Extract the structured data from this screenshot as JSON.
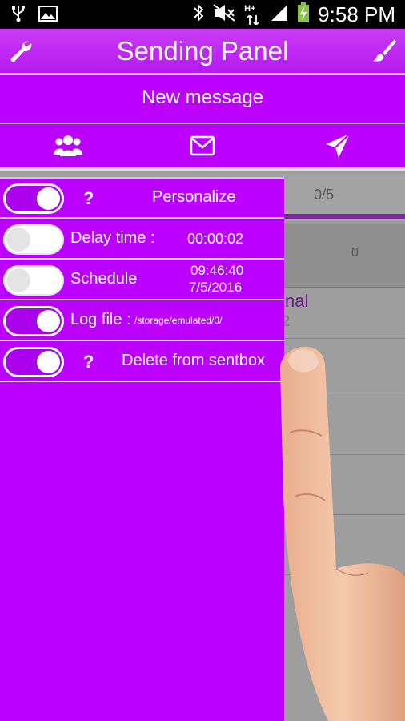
{
  "status_bar": {
    "time": "9:58 PM",
    "icons": [
      "usb-icon",
      "image-icon",
      "bluetooth-icon",
      "mute-icon",
      "hplus-signal-icon",
      "signal-icon",
      "battery-charging-icon"
    ],
    "network_label": "H+"
  },
  "header": {
    "title": "Sending Panel",
    "left_icon": "wrench-icon",
    "right_icon": "brush-icon",
    "color": "#bb00ff"
  },
  "subheader": {
    "title": "New message"
  },
  "icon_bar": {
    "icons": [
      "contacts-icon",
      "envelope-icon",
      "send-icon"
    ]
  },
  "background": {
    "counter": "0/5",
    "zero": "0",
    "fragment1": "nal",
    "fragment2": "2"
  },
  "drawer": {
    "rows": [
      {
        "toggle_on": true,
        "help": "?",
        "label": "Personalize"
      },
      {
        "toggle_on": false,
        "label": "Delay time :",
        "value": "00:00:02"
      },
      {
        "toggle_on": false,
        "label": "Schedule",
        "value_time": "09:46:40",
        "value_date": "7/5/2016"
      },
      {
        "toggle_on": true,
        "label": "Log file :",
        "value": "/storage/emulated/0/"
      },
      {
        "toggle_on": true,
        "help": "?",
        "label": "Delete from sentbox"
      }
    ]
  }
}
